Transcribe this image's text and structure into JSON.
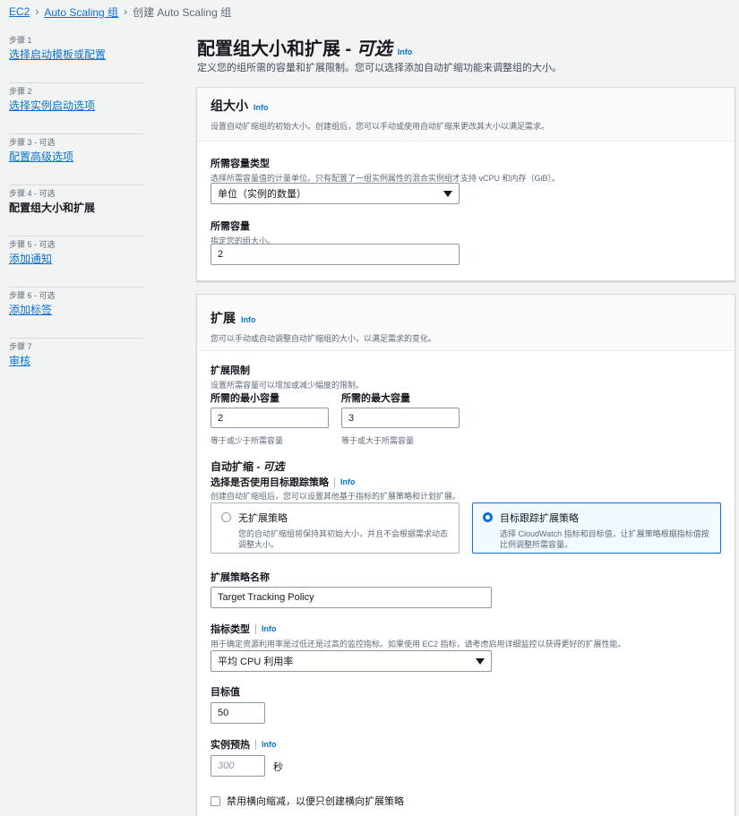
{
  "breadcrumb": {
    "items": [
      "EC2",
      "Auto Scaling 组"
    ],
    "current": "创建 Auto Scaling 组"
  },
  "steps": [
    {
      "num": "步骤 1",
      "name": "选择启动模板或配置"
    },
    {
      "num": "步骤 2",
      "name": "选择实例启动选项"
    },
    {
      "num": "步骤 3 - 可选",
      "name": "配置高级选项"
    },
    {
      "num": "步骤 4 - 可选",
      "name": "配置组大小和扩展"
    },
    {
      "num": "步骤 5 - 可选",
      "name": "添加通知"
    },
    {
      "num": "步骤 6 - 可选",
      "name": "添加标签"
    },
    {
      "num": "步骤 7",
      "name": "审核"
    }
  ],
  "page": {
    "title": "配置组大小和扩展 - ",
    "title_optional": "可选",
    "info": "Info",
    "desc": "定义您的组所需的容量和扩展限制。您可以选择添加自动扩缩功能来调整组的大小。"
  },
  "group_size": {
    "title": "组大小",
    "info": "Info",
    "desc": "设置自动扩缩组的初始大小。创建组后，您可以手动或使用自动扩缩来更改其大小以满足需求。",
    "capacity_type_label": "所需容量类型",
    "capacity_type_desc": "选择所需容量值的计量单位。只有配置了一组实例属性的混合实例组才支持 vCPU 和内存（GiB）。",
    "capacity_type_value": "单位（实例的数量）",
    "desired_label": "所需容量",
    "desired_desc": "指定您的组大小。",
    "desired_value": "2"
  },
  "scaling": {
    "title": "扩展",
    "info": "Info",
    "desc": "您可以手动或自动调整自动扩缩组的大小，以满足需求的变化。",
    "limits_label": "扩展限制",
    "limits_desc": "设置所需容量可以增加或减少幅度的限制。",
    "min_label": "所需的最小容量",
    "min_value": "2",
    "min_hint": "等于或少于所需容量",
    "max_label": "所需的最大容量",
    "max_value": "3",
    "max_hint": "等于或大于所需容量",
    "auto_title": "自动扩缩 - ",
    "auto_title_optional": "可选",
    "auto_question": "选择是否使用目标跟踪策略",
    "auto_info": "Info",
    "auto_desc": "创建自动扩缩组后，您可以设置其他基于指标的扩展策略和计划扩展。",
    "tile_none_name": "无扩展策略",
    "tile_none_desc": "您的自动扩缩组将保持其初始大小，并且不会根据需求动态调整大小。",
    "tile_target_name": "目标跟踪扩展策略",
    "tile_target_desc": "选择 CloudWatch 指标和目标值，让扩展策略根据指标值按比例调整所需容量。",
    "policy_name_label": "扩展策略名称",
    "policy_name_value": "Target Tracking Policy",
    "metric_label": "指标类型",
    "metric_info": "Info",
    "metric_desc": "用于确定资源利用率是过低还是过高的监控指标。如果使用 EC2 指标，请考虑启用详细监控以获得更好的扩展性能。",
    "metric_value": "平均 CPU 利用率",
    "target_label": "目标值",
    "target_value": "50",
    "warmup_label": "实例预热",
    "warmup_info": "Info",
    "warmup_placeholder": "300",
    "warmup_unit": "秒",
    "disable_scale_in_label": "禁用横向缩减，以便只创建横向扩展策略"
  }
}
